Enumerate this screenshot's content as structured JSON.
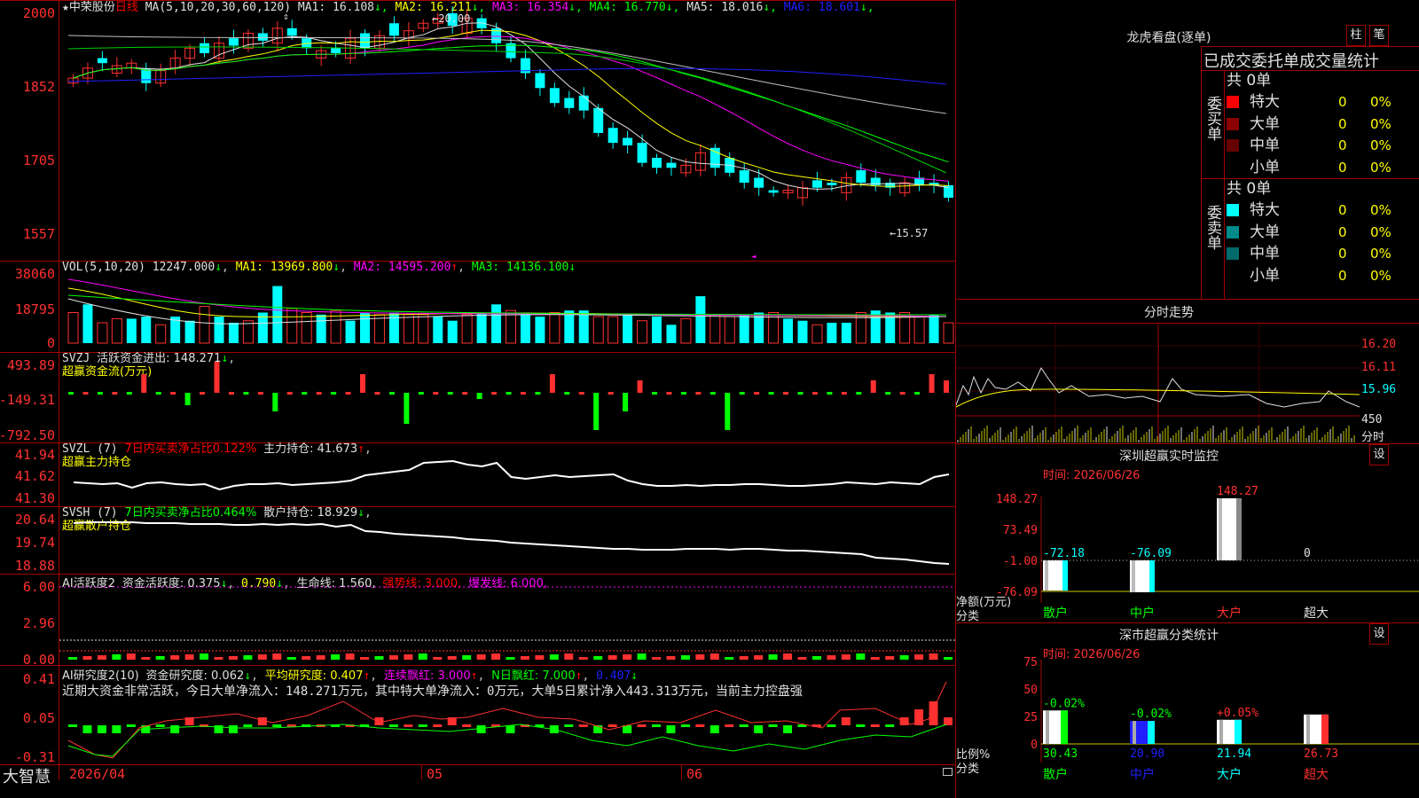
{
  "stock": {
    "star": "★",
    "name": "中荣股份",
    "period": "日线",
    "ma_label": "MA(5,10,20,30,60,120)",
    "ma_values": [
      {
        "label": "MA1:",
        "value": "16.108",
        "dir": "↓",
        "color": "#e0e0e0"
      },
      {
        "label": "MA2:",
        "value": "16.211",
        "dir": "↓",
        "color": "#ffff00"
      },
      {
        "label": "MA3:",
        "value": "16.354",
        "dir": "↓",
        "color": "#ff00ff"
      },
      {
        "label": "MA4:",
        "value": "16.770",
        "dir": "↓",
        "color": "#00ff00"
      },
      {
        "label": "MA5:",
        "value": "18.016",
        "dir": "↓",
        "color": "#e0e0e0"
      },
      {
        "label": "MA6:",
        "value": "18.601",
        "dir": "↓",
        "color": "#2020ff"
      }
    ],
    "price_axis": [
      "2000",
      "1852",
      "1705",
      "1557"
    ],
    "high_label": "20.00",
    "low_label": "15.57"
  },
  "vol": {
    "label": "VOL(5,10,20)",
    "value": "12247.000",
    "ma1": "MA1: 13969.800",
    "ma2": "MA2: 14595.200",
    "ma3": "MA3: 14136.100",
    "axis": [
      "38060",
      "18795",
      "0"
    ]
  },
  "svzj": {
    "label": "SVZJ",
    "title": "活跃资金进出: 148.271",
    "subtitle": "超赢资金流(万元)",
    "axis": [
      "493.89",
      "-149.31",
      "-792.50"
    ]
  },
  "svzl": {
    "label": "SVZL (7)",
    "pct": "7日内买卖净占比0.122%",
    "hold": "主力持仓: 41.673",
    "subtitle": "超赢主力持仓",
    "axis": [
      "41.94",
      "41.62",
      "41.30"
    ]
  },
  "svsh": {
    "label": "SVSH (7)",
    "pct": "7日内买卖净占比0.464%",
    "hold": "散户持仓: 18.929",
    "subtitle": "超赢散户持仓",
    "axis": [
      "20.64",
      "19.74",
      "18.88"
    ]
  },
  "ai_active": {
    "label": "AI活跃度2",
    "a": "资金活跃度: 0.375",
    "b": "0.790",
    "c": "生命线: 1.560,",
    "d": "强势线: 3.000,",
    "e": "爆发线: 6.000,",
    "axis": [
      "6.00",
      "2.96",
      "0.00"
    ]
  },
  "ai_research": {
    "label": "AI研究度2(10)",
    "a": "资金研究度: 0.062",
    "b": "平均研究度: 0.407",
    "c": "连续飘红: 3.000",
    "d": "N日飘红: 7.000",
    "e": "0.407",
    "note": "近期大资金非常活跃，今日大单净流入：148.271万元，其中特大单净流入：0万元，大单5日累计净入443.313万元，当前主力控盘强",
    "axis": [
      "0.41",
      "0.05",
      "-0.31"
    ]
  },
  "footer": {
    "brand": "大智慧",
    "date": "2026/04",
    "m5": "05",
    "m6": "06"
  },
  "dragon": {
    "title": "龙虎看盘(逐单)",
    "btn1": "柱",
    "btn2": "笔",
    "header": "已成交委托单成交量统计",
    "buy_label": "委买单",
    "sell_label": "委卖单",
    "buy_total": "共 0单",
    "sell_total": "共 0单",
    "buy_rows": [
      {
        "name": "特大",
        "v": "0",
        "p": "0%",
        "color": "#ff0000"
      },
      {
        "name": "大单",
        "v": "0",
        "p": "0%",
        "color": "#8b0000"
      },
      {
        "name": "中单",
        "v": "0",
        "p": "0%",
        "color": "#660000"
      },
      {
        "name": "小单",
        "v": "0",
        "p": "0%",
        "color": "#000000"
      }
    ],
    "sell_rows": [
      {
        "name": "特大",
        "v": "0",
        "p": "0%",
        "color": "#00ffff"
      },
      {
        "name": "大单",
        "v": "0",
        "p": "0%",
        "color": "#008b8b"
      },
      {
        "name": "中单",
        "v": "0",
        "p": "0%",
        "color": "#006a6a"
      },
      {
        "name": "小单",
        "v": "0",
        "p": "0%",
        "color": "#000000"
      }
    ]
  },
  "intraday": {
    "title": "分时走势",
    "axis": [
      "16.20",
      "16.11",
      "15.96",
      "450"
    ],
    "unit": "分时"
  },
  "monitor": {
    "title": "深圳超赢实时监控",
    "set": "设",
    "time": "时间: 2026/06/26",
    "axis": [
      "148.27",
      "73.49",
      "-1.00",
      "-76.09"
    ],
    "axis_label": "净额(万元)",
    "cat_label": "分类",
    "values": [
      "-72.18",
      "-76.09",
      "148.27",
      "0"
    ],
    "cats": [
      "散户",
      "中户",
      "大户",
      "超大"
    ]
  },
  "classify": {
    "title": "深市超赢分类统计",
    "set": "设",
    "time": "时间: 2026/06/26",
    "axis": [
      "75",
      "50",
      "25",
      "0"
    ],
    "axis_label": "比例%",
    "cat_label": "分类",
    "pct_top": [
      "-0.02%",
      "-0.02%",
      "+0.05%",
      ""
    ],
    "values": [
      "30.43",
      "20.90",
      "21.94",
      "26.73"
    ],
    "cats": [
      "散户",
      "中户",
      "大户",
      "超大"
    ]
  }
}
